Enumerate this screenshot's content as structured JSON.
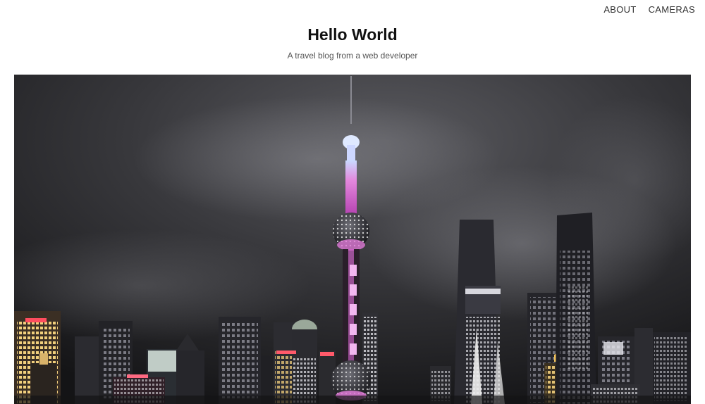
{
  "nav": {
    "about_label": "ABOUT",
    "cameras_label": "CAMERAS"
  },
  "header": {
    "title": "Hello World",
    "subtitle": "A travel blog from a web developer"
  },
  "hero": {
    "icon": "city-skyline-night-photo",
    "colors": {
      "sky": "#2a2a2d",
      "tower_pink": "#e07ad8",
      "tower_blue": "#bcd3ff",
      "window_yellow": "#f3d58a",
      "window_white": "#f4f4f4",
      "neon_red": "#ff4d5e"
    }
  }
}
